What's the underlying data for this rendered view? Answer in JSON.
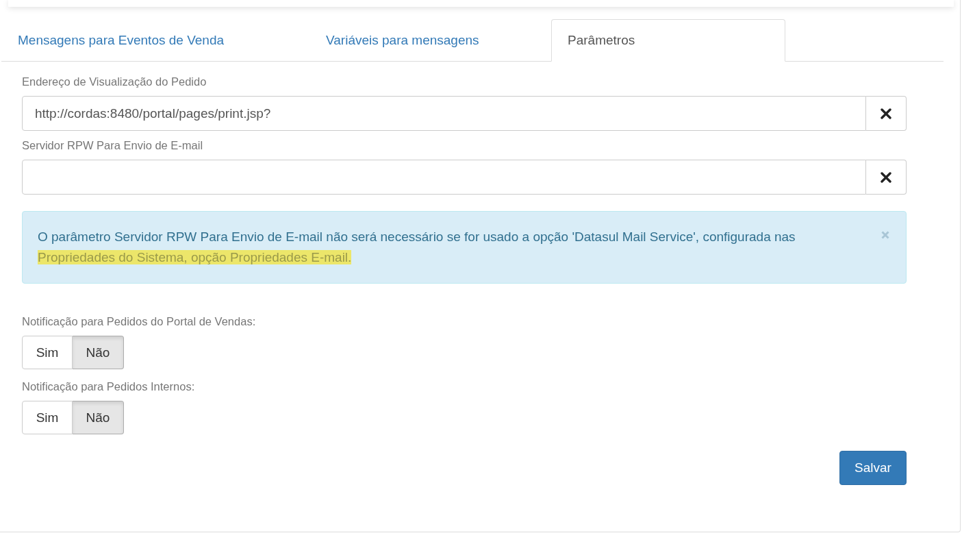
{
  "tabs": [
    {
      "label": "Mensagens para Eventos de Venda",
      "selected": false
    },
    {
      "label": "Variáveis para mensagens",
      "selected": false
    },
    {
      "label": "Parâmetros",
      "selected": true
    }
  ],
  "fields": [
    {
      "label": "Endereço de Visualização do Pedido",
      "value": "http://cordas:8480/portal/pages/print.jsp?"
    },
    {
      "label": "Servidor RPW Para Envio de E-mail"
    }
  ],
  "alert": {
    "text": "O parâmetro Servidor RPW Para Envio de E-mail não será necessário se for usado a opção 'Datasul Mail Service', configurada nas",
    "highlight": "Propriedades do Sistema, opção Propriedades E-mail."
  },
  "toggles": [
    {
      "label": "Notificação para Pedidos do Portal de Vendas:",
      "options": [
        {
          "label": "Sim",
          "selected": false
        },
        {
          "label": "Não",
          "selected": true
        }
      ]
    },
    {
      "label": "Notificação para Pedidos Internos:",
      "options": [
        {
          "label": "Sim",
          "selected": false
        },
        {
          "label": "Não",
          "selected": true
        }
      ]
    }
  ],
  "save_button": "Salvar"
}
